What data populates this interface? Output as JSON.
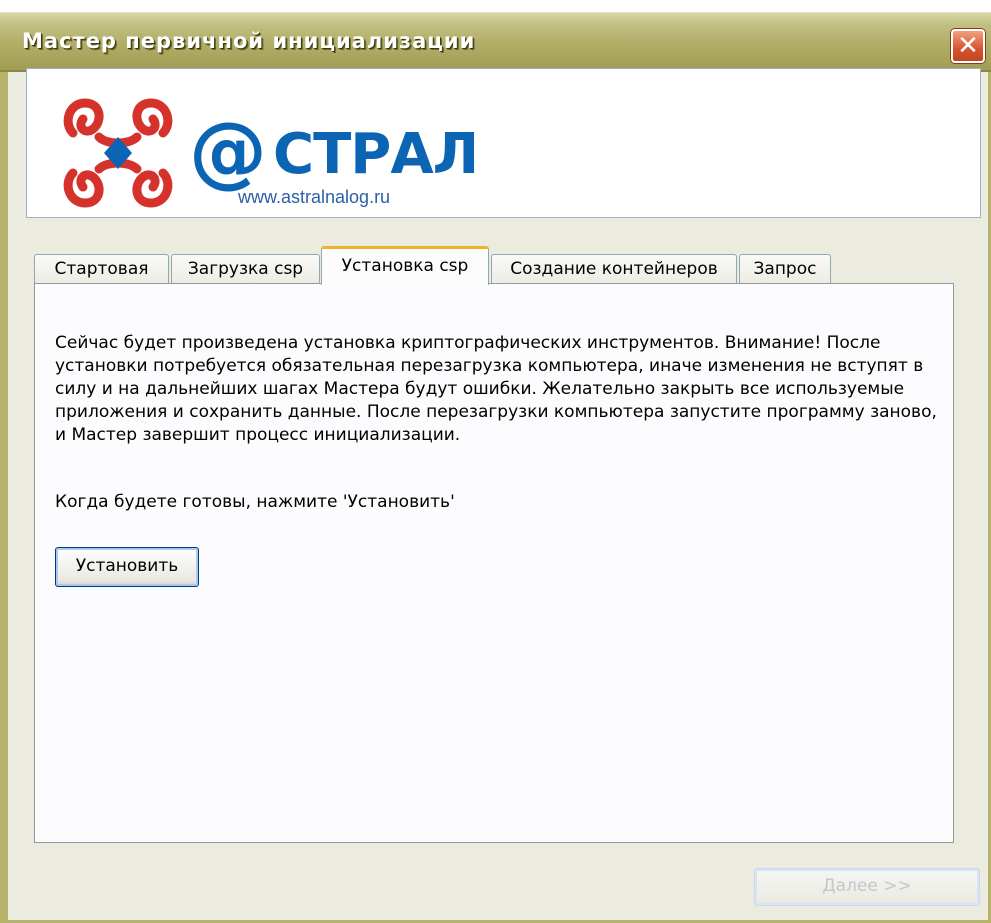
{
  "window": {
    "title": "Мастер первичной инициализации",
    "close_label": "✕"
  },
  "banner": {
    "brand_at": "@",
    "brand_word": "СТРАЛ",
    "url": "www.astralnalog.ru"
  },
  "tabs": [
    {
      "label": "Стартовая",
      "active": false
    },
    {
      "label": "Загрузка csp",
      "active": false
    },
    {
      "label": "Установка csp",
      "active": true
    },
    {
      "label": "Создание контейнеров",
      "active": false
    },
    {
      "label": "Запрос",
      "active": false
    }
  ],
  "content": {
    "paragraph": "Сейчас будет произведена установка криптографических инструментов. Внимание! После установки потребуется обязательная перезагрузка компьютера, иначе изменения не вступят в силу и на дальнейших шагах Мастера будут ошибки. Желательно закрыть все используемые приложения и сохранить данные. После перезагрузки компьютера запустите программу заново, и Мастер завершит процесс инициализации.",
    "prompt": "Когда будете готовы, нажмите 'Установить'",
    "install_button": "Установить"
  },
  "footer": {
    "next_button": "Далее >>",
    "next_enabled": false
  },
  "colors": {
    "title_bar": "#b1ad67",
    "brand_blue": "#0c64b4",
    "logo_red": "#d6322c",
    "active_tab_accent": "#f0b12f"
  }
}
